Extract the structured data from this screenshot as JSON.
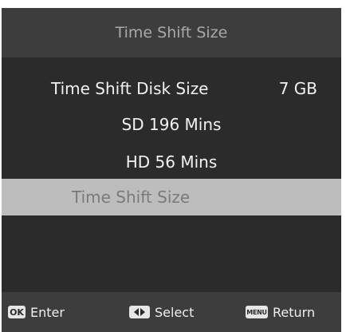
{
  "header": {
    "title": "Time Shift Size"
  },
  "disk": {
    "label": "Time Shift Disk Size",
    "value": "7 GB"
  },
  "sd": {
    "text": "SD 196 Mins"
  },
  "hd": {
    "text": "HD 56 Mins"
  },
  "selected_item": {
    "label": "Time Shift Size"
  },
  "footer": {
    "enter": {
      "key": "OK",
      "label": "Enter",
      "icon": "ok-key-icon"
    },
    "select": {
      "label": "Select",
      "icon": "left-right-arrows-icon"
    },
    "return": {
      "key": "MENU",
      "label": "Return",
      "icon": "menu-key-icon"
    }
  },
  "colors": {
    "background": "#2b2b2b",
    "bar": "#3d3d3d",
    "highlight": "#bdbdbd",
    "text": "#f2f2f2",
    "title_text": "#a9a9a9",
    "highlight_text": "#7a7a7a"
  }
}
